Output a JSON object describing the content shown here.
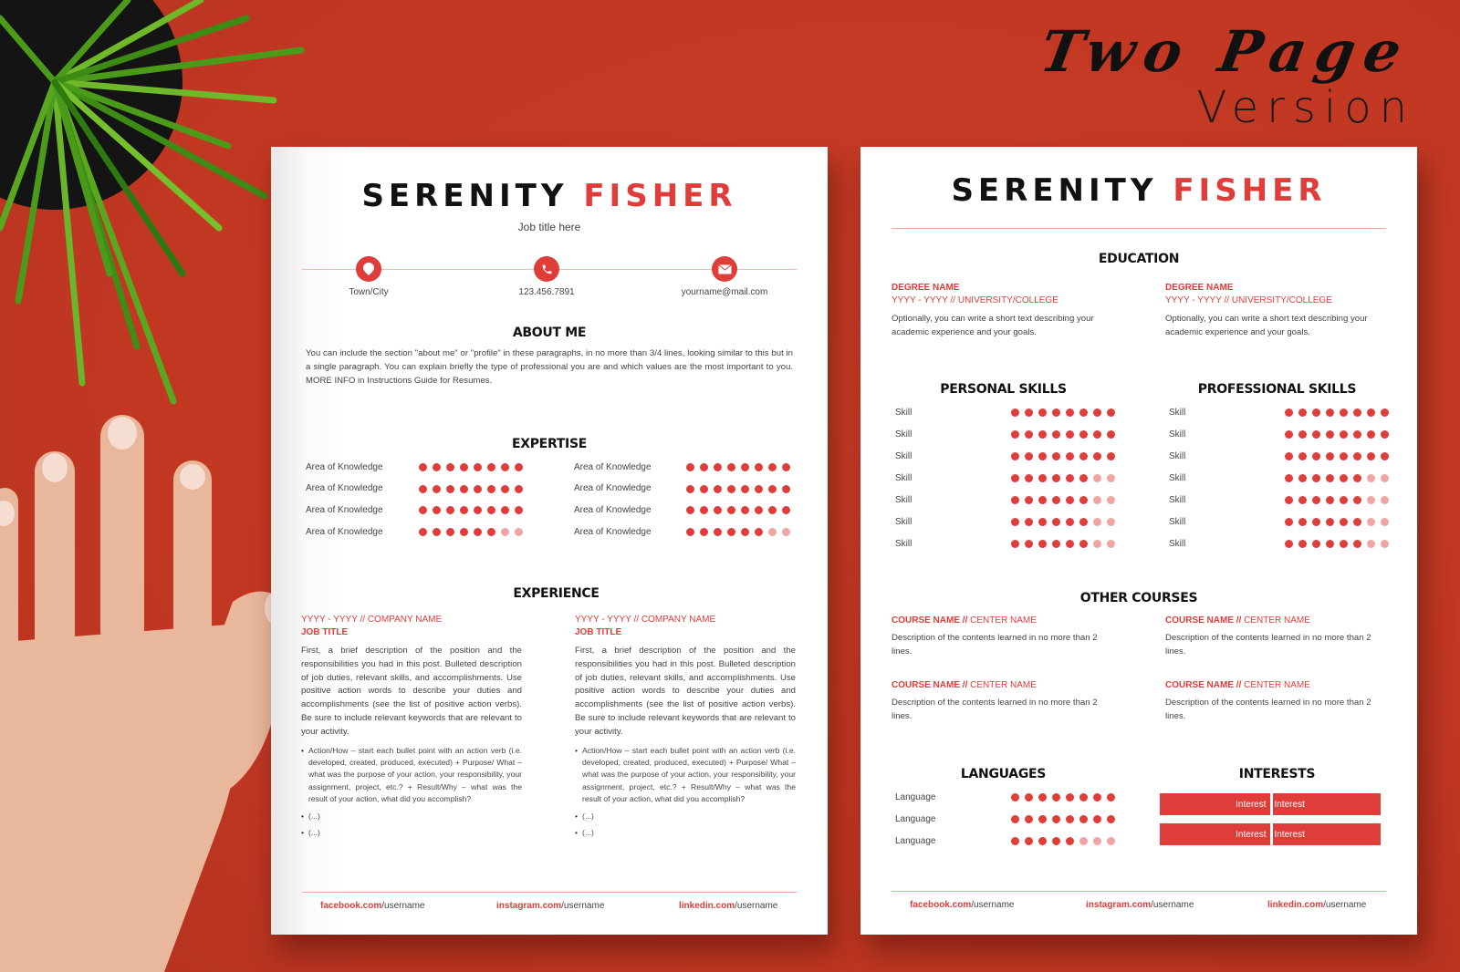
{
  "promo": {
    "line1": "Two Page",
    "line2": "Version"
  },
  "colors": {
    "accent": "#de3d3a",
    "accent_light": "#eea5a3",
    "background": "#c33a24"
  },
  "resume": {
    "first_name": "SERENITY",
    "last_name": "FISHER",
    "job_title": "Job title here"
  },
  "page1": {
    "contacts": [
      {
        "icon": "location-pin-icon",
        "label": "Town/City"
      },
      {
        "icon": "phone-icon",
        "label": "123.456.7891"
      },
      {
        "icon": "envelope-icon",
        "label": "yourname@mail.com"
      }
    ],
    "about": {
      "title": "ABOUT ME",
      "text": "You can include the section \"about me\" or \"profile\" in these paragraphs, in no more than 3/4 lines, looking similar to this but in a single paragraph. You can explain briefly the type of professional you are and which values are the most important to you. MORE INFO in Instructions Guide for Resumes."
    },
    "expertise": {
      "title": "EXPERTISE",
      "max": 8,
      "left": [
        {
          "label": "Area of Knowledge",
          "level": 8
        },
        {
          "label": "Area of Knowledge",
          "level": 8
        },
        {
          "label": "Area of Knowledge",
          "level": 8
        },
        {
          "label": "Area of Knowledge",
          "level": 6
        }
      ],
      "right": [
        {
          "label": "Area of Knowledge",
          "level": 8
        },
        {
          "label": "Area of Knowledge",
          "level": 8
        },
        {
          "label": "Area of Knowledge",
          "level": 8
        },
        {
          "label": "Area of Knowledge",
          "level": 6
        }
      ]
    },
    "experience": {
      "title": "EXPERIENCE",
      "jobs": [
        {
          "dates": "YYYY - YYYY",
          "sep": " // ",
          "company": "COMPANY NAME",
          "job_title": "JOB TITLE",
          "description": "First, a brief description of the position and the responsibilities you had in this post. Bulleted description of job duties, relevant skills, and accomplishments. Use positive action words to describe your duties and accomplishments (see the list of positive action verbs). Be sure to include relevant keywords that are relevant to your activity.",
          "bullets": [
            "Action/How – start each bullet point with an action verb (i.e. developed, created, produced, executed) + Purpose/ What – what was the purpose of your action, your responsibility, your assignment, project, etc.? + Result/Why – what was the result of your action, what did you accomplish?",
            "(...)",
            "(...)"
          ]
        },
        {
          "dates": "YYYY - YYYY",
          "sep": " // ",
          "company": "COMPANY NAME",
          "job_title": "JOB TITLE",
          "description": "First, a brief description of the position and the responsibilities you had in this post. Bulleted description of job duties, relevant skills, and accomplishments. Use positive action words to describe your duties and accomplishments (see the list of positive action verbs). Be sure to include relevant keywords that are relevant to your activity.",
          "bullets": [
            "Action/How – start each bullet point with an action verb (i.e. developed, created, produced, executed) + Purpose/ What – what was the purpose of your action, your responsibility, your assignment, project, etc.? + Result/Why – what was the result of your action, what did you accomplish?",
            "(...)",
            "(...)"
          ]
        }
      ]
    }
  },
  "page2": {
    "education": {
      "title": "EDUCATION",
      "items": [
        {
          "degree": "DEGREE NAME",
          "dates": "YYYY - YYYY",
          "sep": " // ",
          "school": "UNIVERSITY/COLLEGE",
          "text": "Optionally, you can write a short text describing your academic experience and your goals."
        },
        {
          "degree": "DEGREE NAME",
          "dates": "YYYY - YYYY",
          "sep": " // ",
          "school": "UNIVERSITY/COLLEGE",
          "text": "Optionally, you can write a short text describing your academic experience and your goals."
        }
      ]
    },
    "personal_skills": {
      "title": "PERSONAL SKILLS",
      "max": 8,
      "items": [
        {
          "label": "Skill",
          "level": 8
        },
        {
          "label": "Skill",
          "level": 8
        },
        {
          "label": "Skill",
          "level": 8
        },
        {
          "label": "Skill",
          "level": 6
        },
        {
          "label": "Skill",
          "level": 6
        },
        {
          "label": "Skill",
          "level": 6
        },
        {
          "label": "Skill",
          "level": 6
        }
      ]
    },
    "professional_skills": {
      "title": "PROFESSIONAL SKILLS",
      "max": 8,
      "items": [
        {
          "label": "Skill",
          "level": 8
        },
        {
          "label": "Skill",
          "level": 8
        },
        {
          "label": "Skill",
          "level": 8
        },
        {
          "label": "Skill",
          "level": 6
        },
        {
          "label": "Skill",
          "level": 6
        },
        {
          "label": "Skill",
          "level": 6
        },
        {
          "label": "Skill",
          "level": 6
        }
      ]
    },
    "courses": {
      "title": "OTHER COURSES",
      "items": [
        {
          "course": "COURSE NAME",
          "sep": " // ",
          "center": "CENTER NAME",
          "text": "Description of the contents learned in no more than 2 lines."
        },
        {
          "course": "COURSE NAME",
          "sep": " // ",
          "center": "CENTER NAME",
          "text": "Description of the contents learned in no more than 2 lines."
        },
        {
          "course": "COURSE NAME",
          "sep": " // ",
          "center": "CENTER NAME",
          "text": "Description of the contents learned in no more than 2 lines."
        },
        {
          "course": "COURSE NAME",
          "sep": " // ",
          "center": "CENTER NAME",
          "text": "Description of the contents learned in no more than 2 lines."
        }
      ]
    },
    "languages": {
      "title": "LANGUAGES",
      "max": 8,
      "items": [
        {
          "label": "Language",
          "level": 8
        },
        {
          "label": "Language",
          "level": 8
        },
        {
          "label": "Language",
          "level": 5
        }
      ]
    },
    "interests": {
      "title": "INTERESTS",
      "rows": [
        [
          "Interest",
          "Interest"
        ],
        [
          "Interest",
          "Interest"
        ]
      ]
    }
  },
  "footer": {
    "links": [
      {
        "domain": "facebook.com",
        "path": "/username"
      },
      {
        "domain": "instagram.com",
        "path": "/username"
      },
      {
        "domain": "linkedin.com",
        "path": "/username"
      }
    ]
  }
}
